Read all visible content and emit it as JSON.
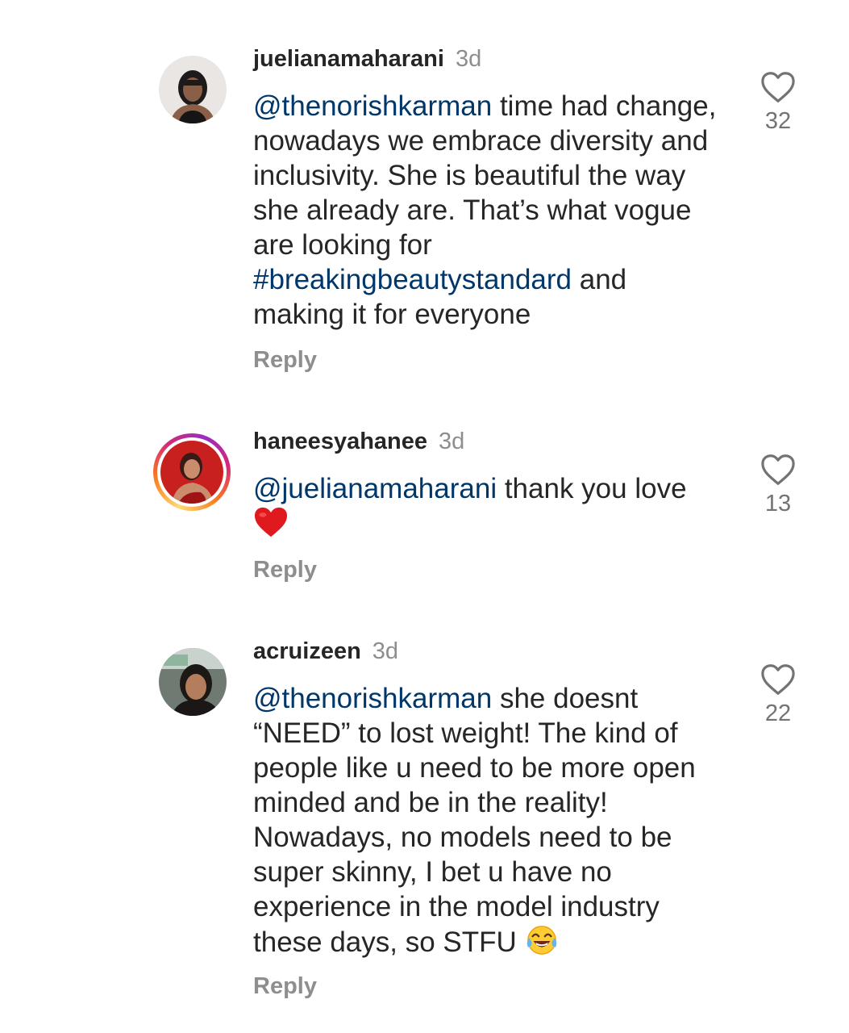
{
  "comments": [
    {
      "username": "juelianamaharani",
      "time": "3d",
      "mention": "@thenorishkarman",
      "text_a": " time had change, nowadays we embrace diversity and inclusivity. She is beautiful the way she already are. That’s what vogue are looking for ",
      "hashtag": "#breakingbeautystandard",
      "text_b": " and making it for everyone",
      "reply": "Reply",
      "likes": "32",
      "avatar": "avatar-woman-black-top"
    },
    {
      "username": "haneesyahanee",
      "time": "3d",
      "mention": "@juelianamaharani",
      "text_a": " thank you love",
      "emoji": "red-heart-emoji",
      "reply": "Reply",
      "likes": "13",
      "avatar": "avatar-woman-red-background",
      "has_story_ring": true
    },
    {
      "username": "acruizeen",
      "time": "3d",
      "mention": "@thenorishkarman",
      "text_a": " she doesnt “NEED” to lost weight! The kind of people like u need to be more open minded and be in the reality! Nowadays, no models need to be super skinny, I bet u have no experience in the model industry these days, so STFU ",
      "emoji": "face-with-tears-of-joy-emoji",
      "reply": "Reply",
      "likes": "22",
      "avatar": "avatar-woman-car-selfie"
    }
  ],
  "colors": {
    "mention": "#00376b",
    "text": "#262626",
    "muted": "#8e8e8e",
    "heart": "#ed4956"
  }
}
